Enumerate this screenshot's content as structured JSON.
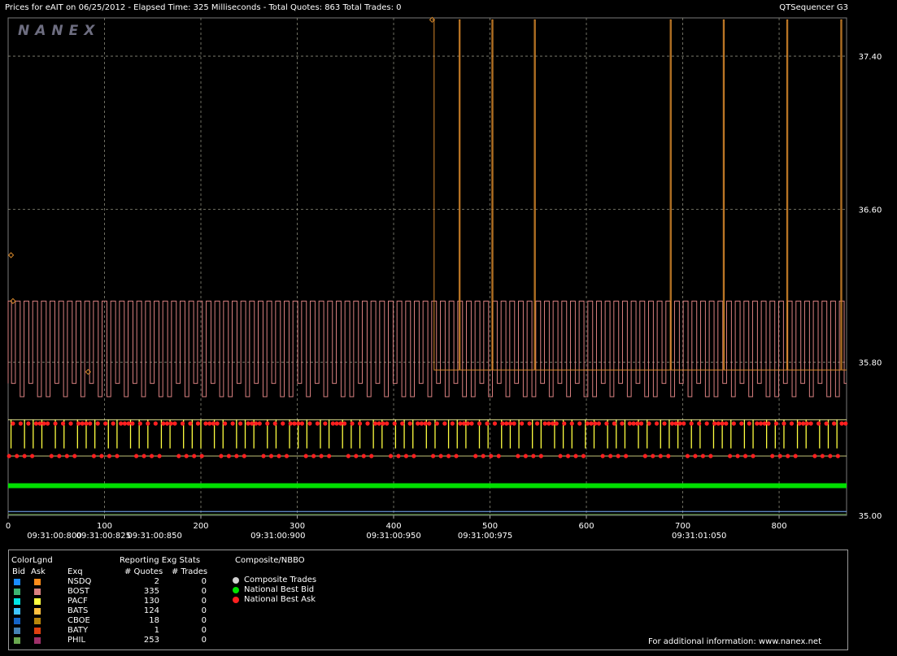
{
  "header": {
    "title": "Prices for  eAIT  on  06/25/2012  -  Elapsed Time: 325 Milliseconds  -  Total Quotes: 863  Total Trades: 0",
    "app": "QTSequencer G3"
  },
  "logo": "NANEX",
  "colors": {
    "background": "#000000",
    "grid": "#8a8a7a",
    "bost_ask": "#d98080",
    "cboe_ask": "#d4862a",
    "pacf_bid": "#ffff40",
    "nbb": "#00e000",
    "nba": "#ff2020",
    "bats_level": "#ffffa0",
    "misc_line": "#7ab0ff"
  },
  "chart_data": {
    "type": "line",
    "x_ticks": [
      "0",
      "100",
      "200",
      "300",
      "400",
      "500",
      "600",
      "700",
      "800"
    ],
    "x_tick_values": [
      0,
      100,
      200,
      300,
      400,
      500,
      600,
      700,
      800
    ],
    "time_labels": [
      "09:31:00:800",
      "09:31:00:825",
      "09:31:00:850",
      "09:31:00:900",
      "09:31:00:950",
      "09:31:00:975",
      "09:31:01:050"
    ],
    "time_label_x": [
      48,
      99,
      152,
      280,
      400,
      495,
      717
    ],
    "y_ticks": [
      "35.00",
      "35.80",
      "36.60",
      "37.40"
    ],
    "y_tick_values": [
      35.0,
      35.8,
      36.6,
      37.4
    ],
    "xlim": [
      0,
      870
    ],
    "ylim": [
      35.0,
      37.6
    ],
    "series": [
      {
        "name": "BOST",
        "side": "Ask",
        "low": 35.62,
        "mid": 35.69,
        "high": 36.12,
        "period": 7
      },
      {
        "name": "CBOE",
        "side": "Ask",
        "base": 35.76,
        "spikes_x": [
          440,
          468,
          502,
          546,
          687,
          742,
          808,
          864
        ],
        "spike_value": 37.59,
        "drop_value": 35.62
      },
      {
        "name": "PACF",
        "side": "Bid",
        "high": 35.5,
        "low": 35.35
      },
      {
        "name": "National Best Bid",
        "value": 35.155
      },
      {
        "name": "National Best Ask",
        "high": 35.48,
        "low": 35.31
      }
    ],
    "marker_points": [
      {
        "x": 3,
        "value": 36.36
      },
      {
        "x": 5,
        "value": 36.12
      },
      {
        "x": 83,
        "value": 35.75
      },
      {
        "x": 440,
        "value": 37.59
      }
    ]
  },
  "legend": {
    "colorlgnd_label": "ColorLgnd",
    "bid_label": "Bid",
    "ask_label": "Ask",
    "exq_label": "Exq",
    "stats_label": "Reporting Exg Stats",
    "quotes_label": "# Quotes",
    "trades_label": "# Trades",
    "rows": [
      {
        "exchange": "NSDQ",
        "quotes": "2",
        "trades": "0",
        "bid_color": "#1a8cff",
        "ask_color": "#ff8c1a"
      },
      {
        "exchange": "BOST",
        "quotes": "335",
        "trades": "0",
        "bid_color": "#3cb371",
        "ask_color": "#d98080"
      },
      {
        "exchange": "PACF",
        "quotes": "130",
        "trades": "0",
        "bid_color": "#00e5e5",
        "ask_color": "#ffff40"
      },
      {
        "exchange": "BATS",
        "quotes": "124",
        "trades": "0",
        "bid_color": "#40c4ff",
        "ask_color": "#ffc040"
      },
      {
        "exchange": "CBOE",
        "quotes": "18",
        "trades": "0",
        "bid_color": "#1464c8",
        "ask_color": "#b8860b"
      },
      {
        "exchange": "BATY",
        "quotes": "1",
        "trades": "0",
        "bid_color": "#4682b4",
        "ask_color": "#e04010"
      },
      {
        "exchange": "PHIL",
        "quotes": "253",
        "trades": "0",
        "bid_color": "#6aa84f",
        "ask_color": "#a0306a"
      }
    ]
  },
  "composite": {
    "title": "Composite/NBBO",
    "items": [
      {
        "label": "Composite Trades",
        "color": "#d0d0d0"
      },
      {
        "label": "National Best Bid",
        "color": "#00e000"
      },
      {
        "label": "National Best Ask",
        "color": "#ff2020"
      }
    ]
  },
  "footer": "For additional information: www.nanex.net"
}
